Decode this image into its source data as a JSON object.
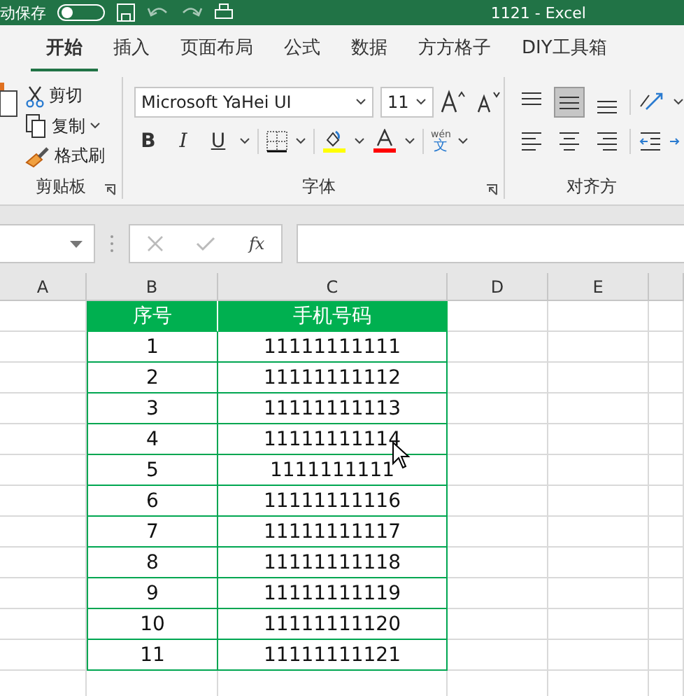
{
  "title_bar": {
    "autosave": {
      "label": "动保存",
      "on": false
    },
    "title": "1121 - Excel"
  },
  "tabs": [
    {
      "label": "开始",
      "selected": true
    },
    {
      "label": "插入",
      "selected": false
    },
    {
      "label": "页面布局",
      "selected": false
    },
    {
      "label": "公式",
      "selected": false
    },
    {
      "label": "数据",
      "selected": false
    },
    {
      "label": "方方格子",
      "selected": false
    },
    {
      "label": "DIY工具箱",
      "selected": false
    }
  ],
  "clipboard": {
    "items": [
      {
        "label": "剪切",
        "kind": "cut",
        "dropdown": false
      },
      {
        "label": "复制",
        "kind": "copy",
        "dropdown": true
      },
      {
        "label": "格式刷",
        "kind": "brush",
        "dropdown": false
      }
    ],
    "group_label": "剪贴板"
  },
  "font": {
    "name": "Microsoft YaHei UI",
    "size": "11",
    "format_buttons": [
      {
        "label": "B",
        "kind": "bold",
        "dropdown": false
      },
      {
        "label": "I",
        "kind": "italic",
        "dropdown": false
      },
      {
        "label": "U",
        "kind": "underline",
        "dropdown": true
      }
    ],
    "phonetic": {
      "top": "wén",
      "bottom": "文"
    },
    "group_label": "字体"
  },
  "alignment": {
    "top_row": [
      {
        "kind": "top",
        "selected": false
      },
      {
        "kind": "middle",
        "selected": true
      },
      {
        "kind": "bottom",
        "selected": false
      }
    ],
    "bottom_row": [
      {
        "kind": "left",
        "selected": false
      },
      {
        "kind": "center",
        "selected": false
      },
      {
        "kind": "right",
        "selected": false
      }
    ],
    "group_label": "对齐方"
  },
  "formula_bar": {
    "fx": "fx"
  },
  "sheet": {
    "columns": [
      "A",
      "B",
      "C",
      "D",
      "E"
    ],
    "rows": [
      [
        null,
        "序号",
        "手机号码",
        null,
        null
      ],
      [
        null,
        "1",
        "11111111111",
        null,
        null
      ],
      [
        null,
        "2",
        "11111111112",
        null,
        null
      ],
      [
        null,
        "3",
        "11111111113",
        null,
        null
      ],
      [
        null,
        "4",
        "11111111114",
        null,
        null
      ],
      [
        null,
        "5",
        "1111111111",
        null,
        null
      ],
      [
        null,
        "6",
        "11111111116",
        null,
        null
      ],
      [
        null,
        "7",
        "11111111117",
        null,
        null
      ],
      [
        null,
        "8",
        "11111111118",
        null,
        null
      ],
      [
        null,
        "9",
        "11111111119",
        null,
        null
      ],
      [
        null,
        "10",
        "11111111120",
        null,
        null
      ],
      [
        null,
        "11",
        "11111111121",
        null,
        null
      ]
    ]
  }
}
